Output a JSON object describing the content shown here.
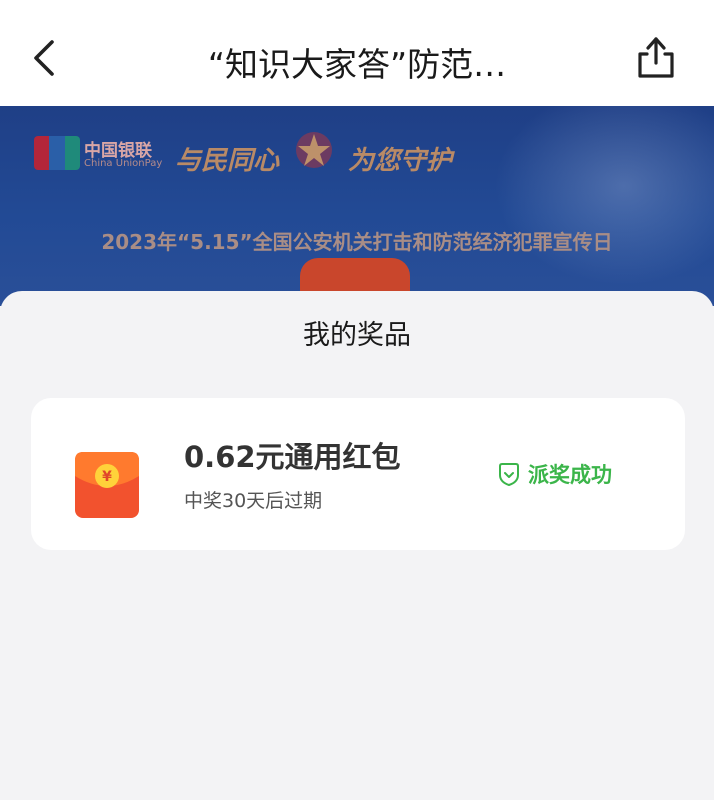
{
  "header": {
    "title": "“知识大家答”防范…",
    "back_icon": "chevron-left-icon",
    "share_icon": "share-icon"
  },
  "banner": {
    "unionpay_cn": "中国银联",
    "unionpay_en": "China UnionPay",
    "unionpay_badge": "UnionPay 银联",
    "slogan_left": "与民同心",
    "slogan_right": "为您守护",
    "headline": "2023年“5.15”全国公安机关打击和防范经济犯罪宣传日"
  },
  "sheet": {
    "title": "我的奖品",
    "prize": {
      "name": "0.62元通用红包",
      "expiry": "中奖30天后过期",
      "status": "派奖成功",
      "status_icon": "shield-check-icon",
      "envelope_icon": "red-envelope-icon",
      "envelope_symbol": "¥"
    }
  },
  "colors": {
    "status_green": "#3bb54a",
    "envelope_red": "#f2522e",
    "banner_blue": "#224a95"
  }
}
